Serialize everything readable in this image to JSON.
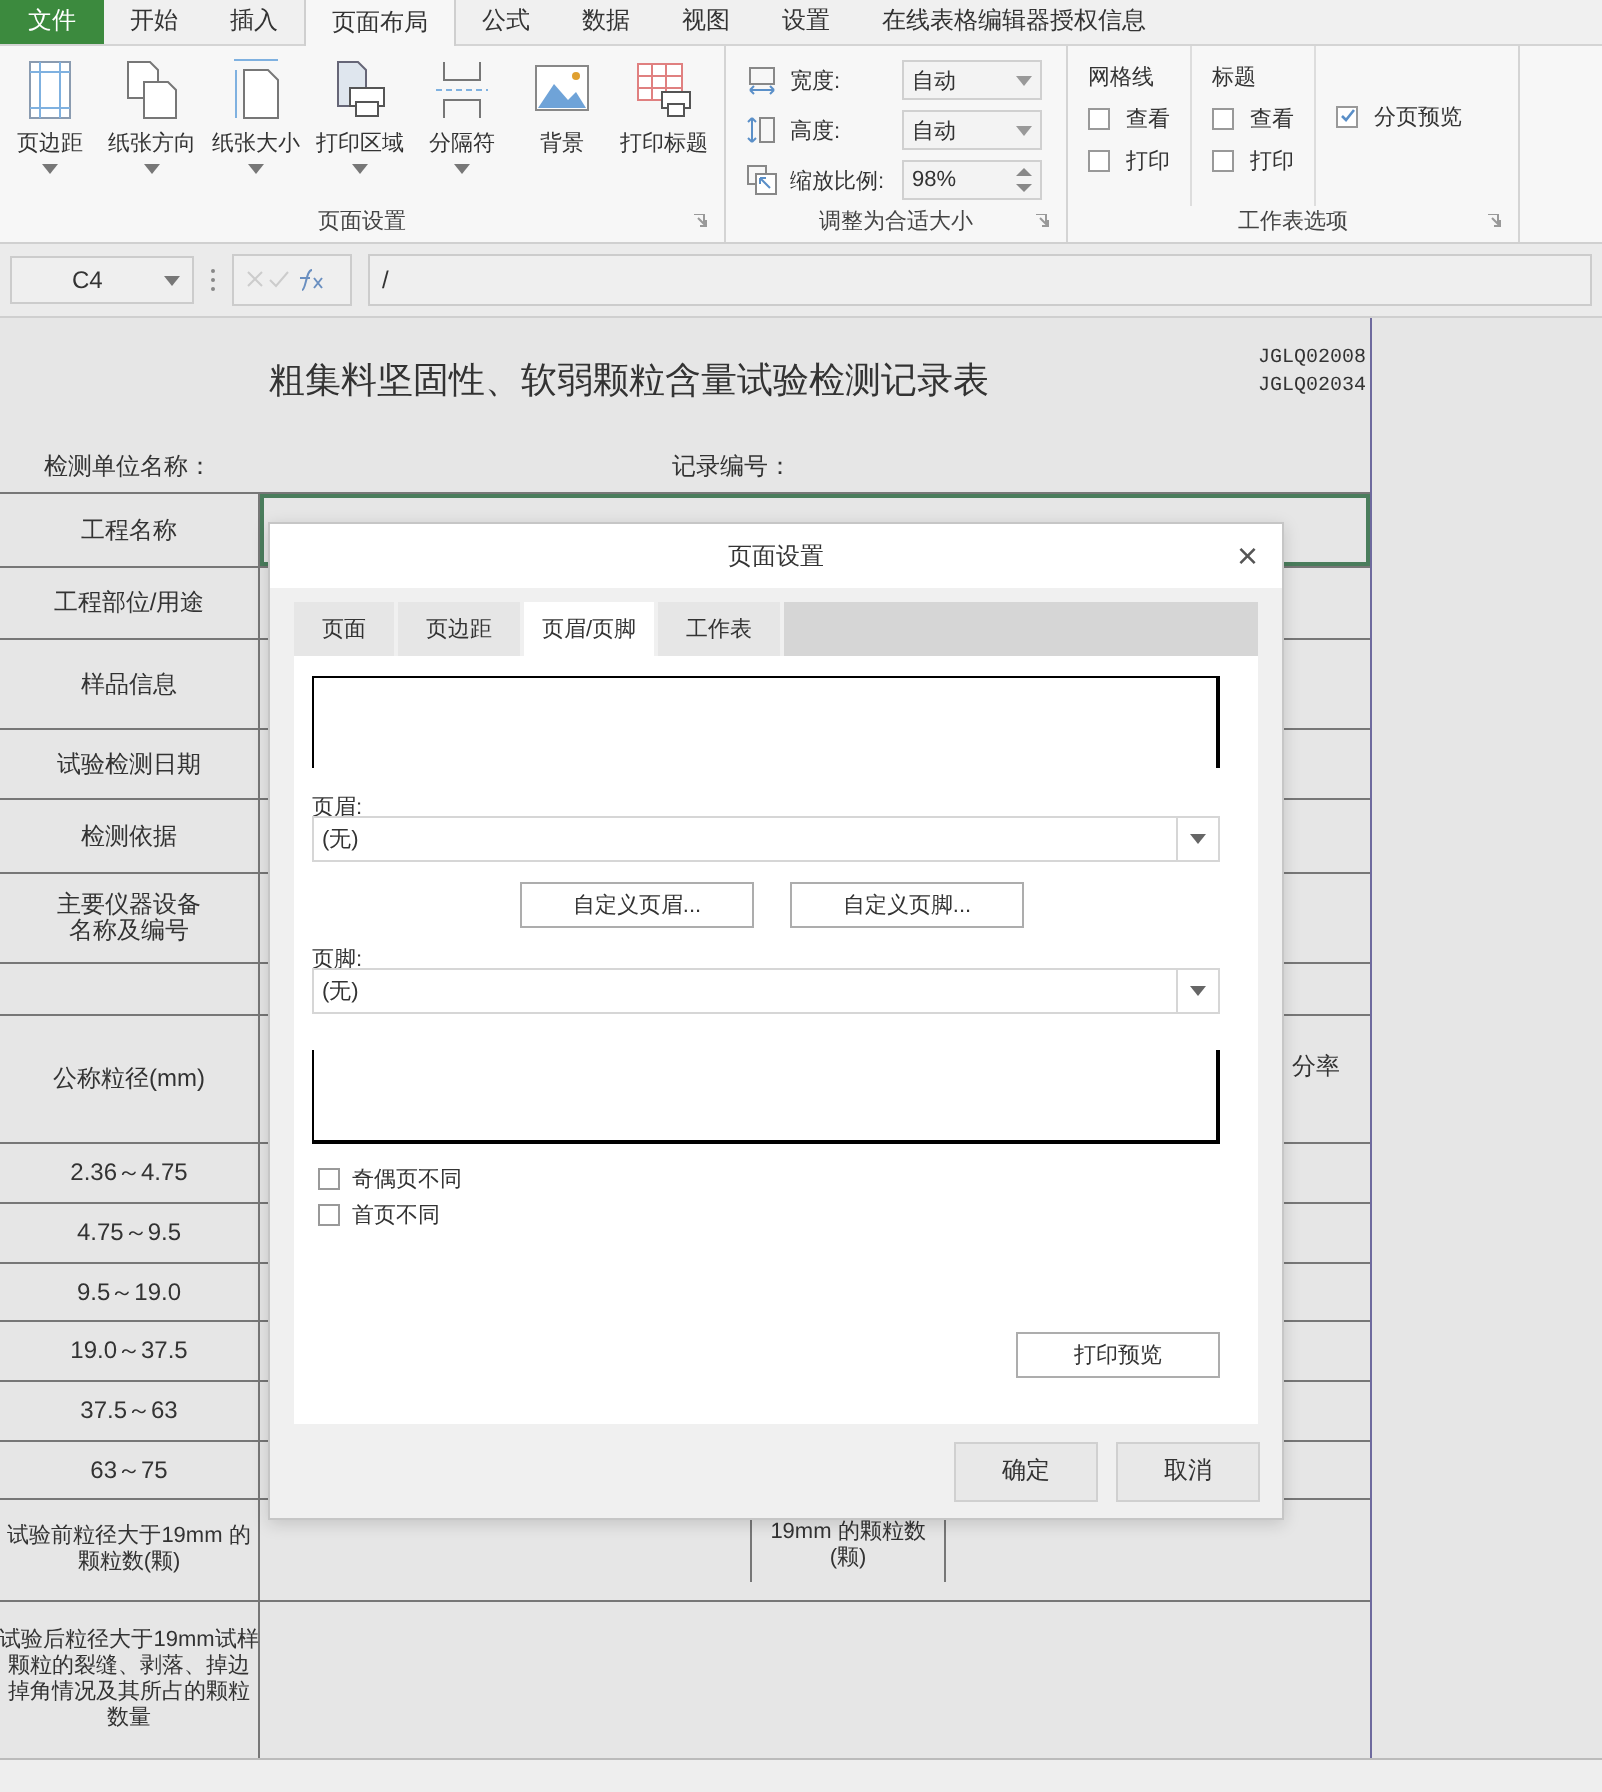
{
  "menu_tabs": [
    {
      "label": "文件",
      "kind": "file",
      "selected": false
    },
    {
      "label": "开始",
      "kind": "tab",
      "selected": false
    },
    {
      "label": "插入",
      "kind": "tab",
      "selected": false
    },
    {
      "label": "页面布局",
      "kind": "tab",
      "selected": true
    },
    {
      "label": "公式",
      "kind": "tab",
      "selected": false
    },
    {
      "label": "数据",
      "kind": "tab",
      "selected": false
    },
    {
      "label": "视图",
      "kind": "tab",
      "selected": false
    },
    {
      "label": "设置",
      "kind": "tab",
      "selected": false
    },
    {
      "label": "在线表格编辑器授权信息",
      "kind": "tab",
      "selected": false
    }
  ],
  "page_setup_group": {
    "title": "页面设置",
    "buttons": [
      {
        "label": "页边距",
        "kind": "margins",
        "has_menu": true
      },
      {
        "label": "纸张方向",
        "kind": "orientation",
        "has_menu": true
      },
      {
        "label": "纸张大小",
        "kind": "size",
        "has_menu": true
      },
      {
        "label": "打印区域",
        "kind": "print_area",
        "has_menu": true
      },
      {
        "label": "分隔符",
        "kind": "breaks",
        "has_menu": true
      },
      {
        "label": "背景",
        "kind": "background",
        "has_menu": false
      },
      {
        "label": "打印标题",
        "kind": "print_titles",
        "has_menu": false
      }
    ]
  },
  "scale_group": {
    "title": "调整为合适大小",
    "fields": [
      {
        "kind": "width",
        "label": "宽度:",
        "value": "自动"
      },
      {
        "kind": "height",
        "label": "高度:",
        "value": "自动"
      },
      {
        "kind": "scale",
        "label": "缩放比例:",
        "value": "98%"
      }
    ]
  },
  "sheet_options_group": {
    "title": "工作表选项",
    "columns": [
      {
        "heading": "网格线",
        "options": [
          {
            "label": "查看",
            "checked": false
          },
          {
            "label": "打印",
            "checked": false
          }
        ]
      },
      {
        "heading": "标题",
        "options": [
          {
            "label": "查看",
            "checked": false
          },
          {
            "label": "打印",
            "checked": false
          }
        ]
      }
    ],
    "extra_options": [
      {
        "label": "分页预览",
        "checked": true
      }
    ]
  },
  "formula_bar": {
    "cell_ref": "C4",
    "formula": "/"
  },
  "sheet": {
    "title": "粗集料坚固性、软弱颗粒含量试验检测记录表",
    "codes": [
      "JGLQ02008",
      "JGLQ02034"
    ],
    "fields": [
      "检测单位名称：",
      "记录编号："
    ],
    "rows": [
      {
        "kind": "label",
        "lines": [
          "工程名称"
        ],
        "selected": true
      },
      {
        "kind": "label",
        "lines": [
          "工程部位/用途"
        ],
        "selected": false
      },
      {
        "kind": "label",
        "lines": [
          "样品信息"
        ],
        "selected": false
      },
      {
        "kind": "label",
        "lines": [
          "试验检测日期"
        ],
        "selected": false
      },
      {
        "kind": "label",
        "lines": [
          "检测依据"
        ],
        "selected": false
      },
      {
        "kind": "label",
        "lines": [
          "主要仪器设备",
          "名称及编号"
        ],
        "selected": false
      },
      {
        "kind": "blank",
        "selected": false
      },
      {
        "kind": "label",
        "lines": [
          "公称粒径(mm)"
        ],
        "right_text": "分率",
        "selected": false
      },
      {
        "kind": "label",
        "lines": [
          "2.36～4.75"
        ],
        "selected": false
      },
      {
        "kind": "label",
        "lines": [
          "4.75～9.5"
        ],
        "selected": false
      },
      {
        "kind": "label",
        "lines": [
          "9.5～19.0"
        ],
        "selected": false
      },
      {
        "kind": "label",
        "lines": [
          "19.0～37.5"
        ],
        "selected": false
      },
      {
        "kind": "label",
        "lines": [
          "37.5～63"
        ],
        "selected": false
      },
      {
        "kind": "label",
        "lines": [
          "63～75"
        ],
        "selected": false
      },
      {
        "kind": "split",
        "lines": [
          "试验前粒径大于19mm 的",
          "颗粒数(颗)"
        ],
        "mid_lines": [
          "19mm 的颗粒数",
          "(颗)"
        ],
        "selected": false
      },
      {
        "kind": "label",
        "lines": [
          "试验后粒径大于19mm试样",
          "颗粒的裂缝、剥落、掉边",
          "掉角情况及其所占的颗粒",
          "数量"
        ],
        "selected": false
      }
    ]
  },
  "dialog": {
    "title": "页面设置",
    "close": "×",
    "tabs": [
      {
        "label": "页面",
        "selected": false
      },
      {
        "label": "页边距",
        "selected": false
      },
      {
        "label": "页眉/页脚",
        "selected": true
      },
      {
        "label": "工作表",
        "selected": false
      }
    ],
    "header_label": "页眉:",
    "header_value": "(无)",
    "custom_buttons": [
      "自定义页眉...",
      "自定义页脚..."
    ],
    "footer_label": "页脚:",
    "footer_value": "(无)",
    "options": [
      {
        "label": "奇偶页不同",
        "checked": false
      },
      {
        "label": "首页不同",
        "checked": false
      }
    ],
    "preview_button": "打印预览",
    "buttons": [
      "确定",
      "取消"
    ]
  }
}
